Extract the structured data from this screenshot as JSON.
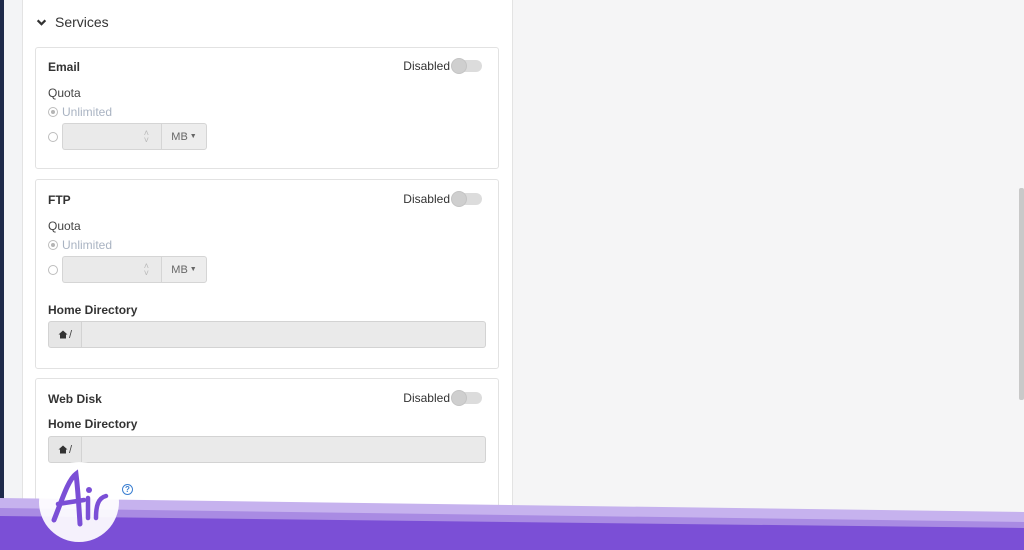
{
  "section": {
    "title": "Services"
  },
  "email": {
    "title": "Email",
    "status": "Disabled",
    "quota_label": "Quota",
    "unlimited_label": "Unlimited",
    "unit": "MB"
  },
  "ftp": {
    "title": "FTP",
    "status": "Disabled",
    "quota_label": "Quota",
    "unlimited_label": "Unlimited",
    "unit": "MB",
    "home_label": "Home Directory",
    "home_prefix": "/"
  },
  "webdisk": {
    "title": "Web Disk",
    "status": "Disabled",
    "home_label": "Home Directory",
    "home_prefix": "/"
  },
  "brand": {
    "logo_text": "Air",
    "accent": "#7b4fd6",
    "light_band": "#c6b2ee"
  },
  "icons": {
    "section": "chevron-down-icon",
    "home": "home-icon",
    "help": "help-icon"
  }
}
